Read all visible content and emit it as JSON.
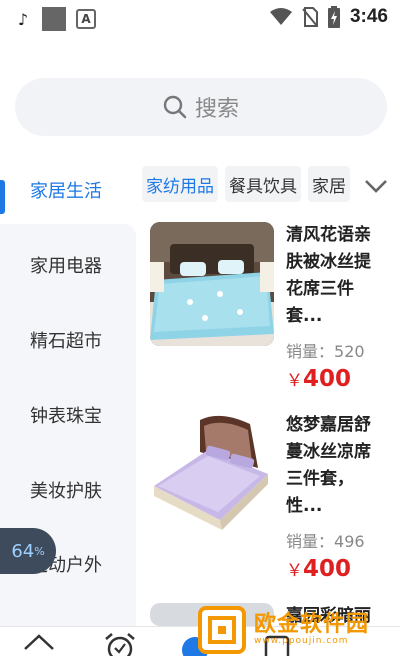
{
  "status_bar": {
    "time": "3:46",
    "app_icons": [
      "tiktok-icon",
      "notification-square-icon",
      "a-icon"
    ],
    "system_icons": [
      "wifi-icon",
      "no-sim-icon",
      "battery-charging-icon"
    ]
  },
  "search": {
    "placeholder": "搜索",
    "icon": "search-icon"
  },
  "sidebar": {
    "items": [
      {
        "label": "家居生活",
        "active": true
      },
      {
        "label": "家用电器",
        "active": false
      },
      {
        "label": "精石超市",
        "active": false
      },
      {
        "label": "钟表珠宝",
        "active": false
      },
      {
        "label": "美妆护肤",
        "active": false
      },
      {
        "label": "运动户外",
        "active": false
      }
    ]
  },
  "floating_badge": {
    "value": "64",
    "unit": "%"
  },
  "category_tabs": {
    "items": [
      {
        "label": "家纺用品",
        "active": true
      },
      {
        "label": "餐具饮具",
        "active": false
      },
      {
        "label": "家居",
        "active": false
      }
    ],
    "more_icon": "chevron-down-icon"
  },
  "products": [
    {
      "title": "清风花语亲肤被冰丝提花席三件套...",
      "sales_label": "销量：",
      "sales": "520",
      "currency": "￥",
      "price": "400"
    },
    {
      "title": "悠梦嘉居舒蔓冰丝凉席三件套，性...",
      "sales_label": "销量：",
      "sales": "496",
      "currency": "￥",
      "price": "400"
    },
    {
      "title": "嘉园彩暗丽",
      "sales_label": "",
      "sales": "",
      "currency": "",
      "price": ""
    }
  ],
  "bottom_nav": {
    "icons": [
      "home-icon",
      "alarm-clock-icon",
      "category-icon",
      "cart-icon"
    ]
  },
  "watermark": {
    "text": "欧金软件园",
    "sub": "www.ppoujin.com"
  },
  "colors": {
    "accent": "#1e78e6",
    "price": "#e02020",
    "sidebar_bg": "#f4f6f9",
    "watermark": "#f39800"
  }
}
